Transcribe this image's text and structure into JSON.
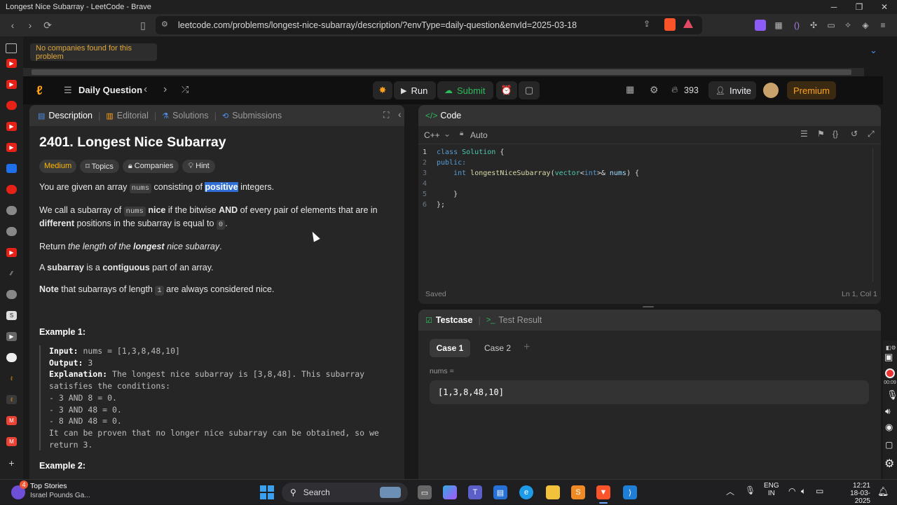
{
  "window": {
    "title": "Longest Nice Subarray - LeetCode - Brave",
    "controls": [
      "─",
      "❐",
      "✕"
    ]
  },
  "browser": {
    "url": "leetcode.com/problems/longest-nice-subarray/description/?envType=daily-question&envId=2025-03-18"
  },
  "notice": "No companies found for this problem",
  "nav": {
    "daily_label": "Daily Question",
    "run_label": "Run",
    "submit_label": "Submit",
    "streak_count": "393",
    "invite_label": "Invite",
    "premium_label": "Premium"
  },
  "left_panel": {
    "tabs": [
      "Description",
      "Editorial",
      "Solutions",
      "Submissions"
    ],
    "title": "2401. Longest Nice Subarray",
    "difficulty": "Medium",
    "chips": [
      "Topics",
      "Companies",
      "Hint"
    ],
    "p1": {
      "a": "You are given an array ",
      "code": "nums",
      "b": " consisting of ",
      "sel": "positive",
      "c": " integers."
    },
    "p2": {
      "a": "We call a subarray of ",
      "code1": "nums",
      "b": " ",
      "nice": "nice",
      "c": " if the bitwise ",
      "and": "AND",
      "d": " of every pair of elements that are in ",
      "different": "different",
      "e": " positions in the subarray is equal to ",
      "code2": "0",
      "f": "."
    },
    "p3": {
      "a": "Return ",
      "i1": "the length of the ",
      "longest": "longest",
      "i2": " nice subarray",
      "b": "."
    },
    "p4": {
      "a": "A ",
      "subarray": "subarray",
      "b": " is a ",
      "contiguous": "contiguous",
      "c": " part of an array."
    },
    "p5": {
      "note": "Note",
      "a": " that subarrays of length ",
      "code": "1",
      "b": " are always considered nice."
    },
    "example1_title": "Example 1:",
    "example1": {
      "input_label": "Input:",
      "input": " nums = [1,3,8,48,10]",
      "output_label": "Output:",
      "output": " 3",
      "expl_label": "Explanation:",
      "expl": " The longest nice subarray is [3,8,48]. This subarray",
      "lines": [
        "satisfies the conditions:",
        "- 3 AND 8 = 0.",
        "- 3 AND 48 = 0.",
        "- 8 AND 48 = 0.",
        "It can be proven that no longer nice subarray can be obtained, so we",
        "return 3."
      ]
    },
    "example2_title": "Example 2:"
  },
  "code_panel": {
    "title": "Code",
    "language": "C++",
    "mode": "Auto",
    "line_numbers": [
      "1",
      "2",
      "3",
      "4",
      "5",
      "6"
    ],
    "saved": "Saved",
    "cursor": "Ln 1, Col 1"
  },
  "test_panel": {
    "tabs": [
      "Testcase",
      "Test Result"
    ],
    "cases": [
      "Case 1",
      "Case 2"
    ],
    "add": "+",
    "var_label": "nums =",
    "var_value": "[1,3,8,48,10]"
  },
  "right_strip": {
    "time": "00:09"
  },
  "taskbar": {
    "badge": "4",
    "news_title": "Top Stories",
    "news_sub": "Israel Pounds Ga...",
    "search": "Search",
    "lang1": "ENG",
    "lang2": "IN",
    "time": "12:21",
    "date": "18-03-2025"
  },
  "colors": {
    "accent_orange": "#ffa116",
    "green": "#2cbb5d",
    "medium": "#ffb800",
    "selection": "#2f6fd6"
  }
}
